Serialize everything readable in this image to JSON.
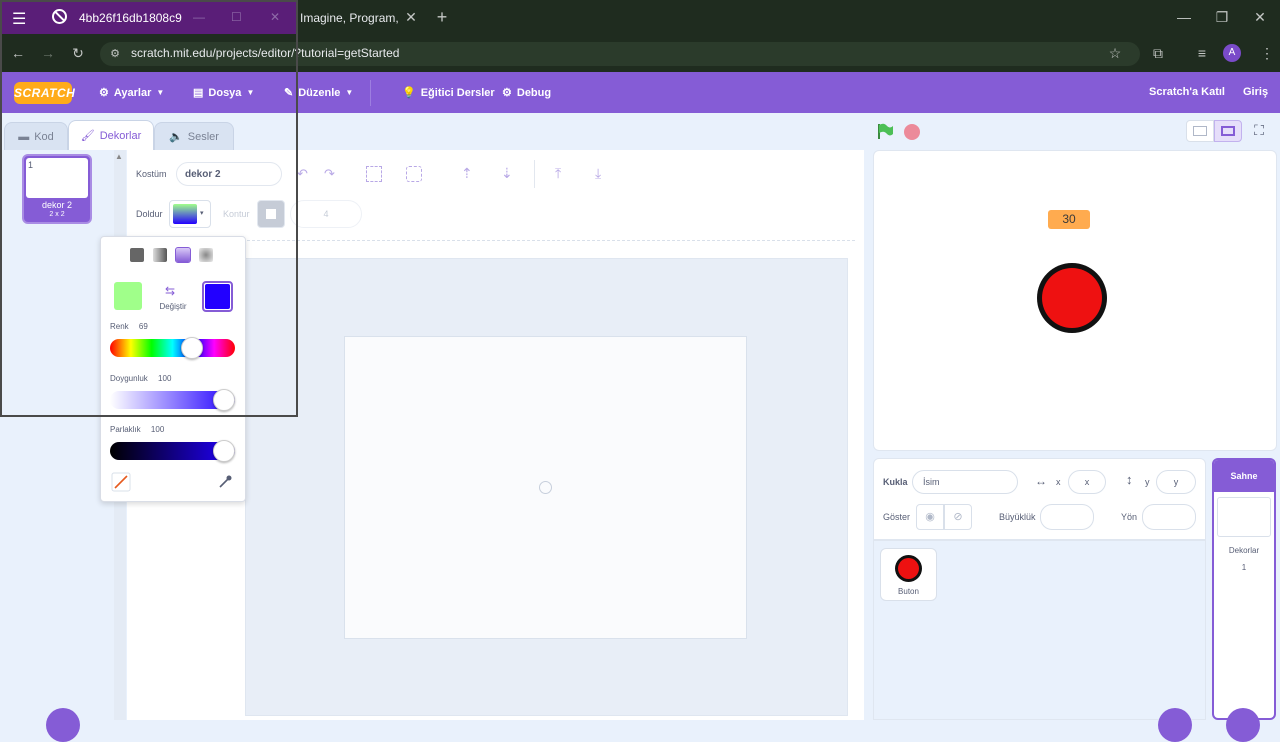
{
  "browser": {
    "overlay_title": "4bb26f16db1808c9",
    "tab_title": "Imagine, Program, Sh",
    "url": "scratch.mit.edu/projects/editor/?tutorial=getStarted",
    "profile_initial": "A"
  },
  "menubar": {
    "logo": "SCRATCH",
    "settings": "Ayarlar",
    "file": "Dosya",
    "edit": "Düzenle",
    "tutorials": "Eğitici Dersler",
    "debug": "Debug",
    "join": "Scratch'a Katıl",
    "signin": "Giriş"
  },
  "tabs": {
    "code": "Kod",
    "costumes": "Dekorlar",
    "sounds": "Sesler"
  },
  "costume_list": {
    "index": "1",
    "name": "dekor 2",
    "size": "2 x 2"
  },
  "paint": {
    "costume_label": "Kostüm",
    "costume_name": "dekor 2",
    "fill_label": "Doldur",
    "outline_label": "Kontur",
    "outline_size": "4"
  },
  "color_popup": {
    "swap_label": "Değiştir",
    "hue_label": "Renk",
    "hue_value": "69",
    "saturation_label": "Doygunluk",
    "saturation_value": "100",
    "brightness_label": "Parlaklık",
    "brightness_value": "100",
    "color_start": "#a0ff8a",
    "color_end": "#2200ff",
    "hue_fraction": 0.69,
    "saturation_fraction": 1.0,
    "brightness_fraction": 1.0
  },
  "stage": {
    "counter": "30",
    "button_color": "#ee1111"
  },
  "sprite_info": {
    "sprite_label": "Kukla",
    "name_placeholder": "İsim",
    "x_label": "x",
    "x_placeholder": "x",
    "y_label": "y",
    "y_placeholder": "y",
    "show_label": "Göster",
    "size_label": "Büyüklük",
    "direction_label": "Yön"
  },
  "sprites": [
    {
      "name": "Buton"
    }
  ],
  "stage_panel": {
    "title": "Sahne",
    "backdrops_label": "Dekorlar",
    "backdrops_count": "1"
  },
  "colors": {
    "accent": "#855cd6",
    "menubar": "#855cd6",
    "counter_bg": "#ffab4f",
    "green_flag": "#4cbf56",
    "stop": "#ec5959"
  }
}
